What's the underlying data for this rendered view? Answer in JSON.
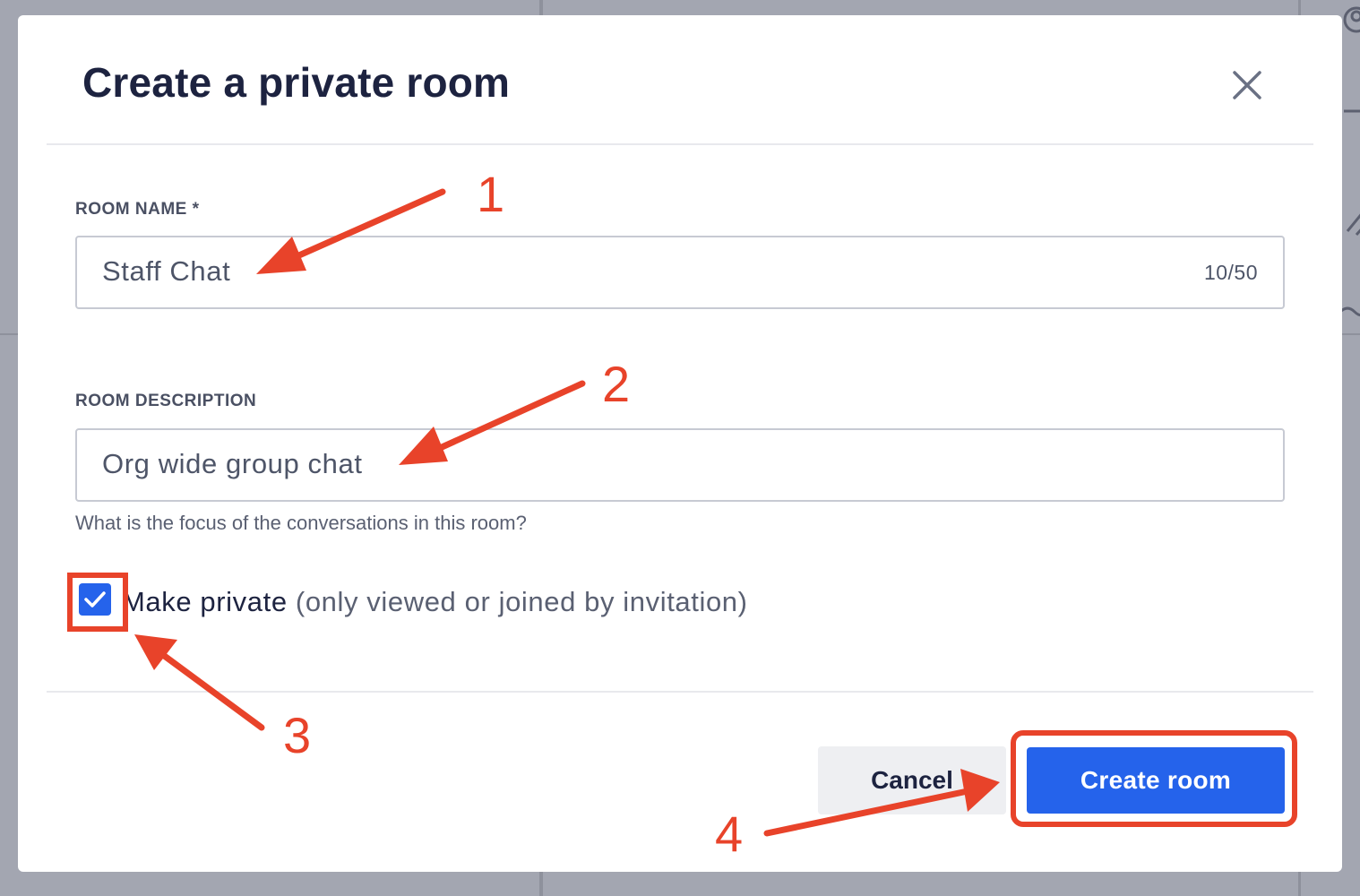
{
  "dialog": {
    "title": "Create a private room",
    "close_icon": "close-icon"
  },
  "room_name": {
    "label": "ROOM NAME *",
    "value": "Staff Chat",
    "char_count": "10/50"
  },
  "room_description": {
    "label": "ROOM DESCRIPTION",
    "value": "Org wide group chat",
    "hint": "What is the focus of the conversations in this room?"
  },
  "private_option": {
    "checked": true,
    "label": "Make private",
    "sublabel": "(only viewed or joined by invitation)"
  },
  "buttons": {
    "cancel": "Cancel",
    "create": "Create room"
  },
  "annotations": {
    "steps": [
      "1",
      "2",
      "3",
      "4"
    ],
    "color": "#e8432a"
  },
  "colors": {
    "primary": "#2563eb",
    "title": "#1d2340",
    "backdrop": "#9ea1ad"
  }
}
